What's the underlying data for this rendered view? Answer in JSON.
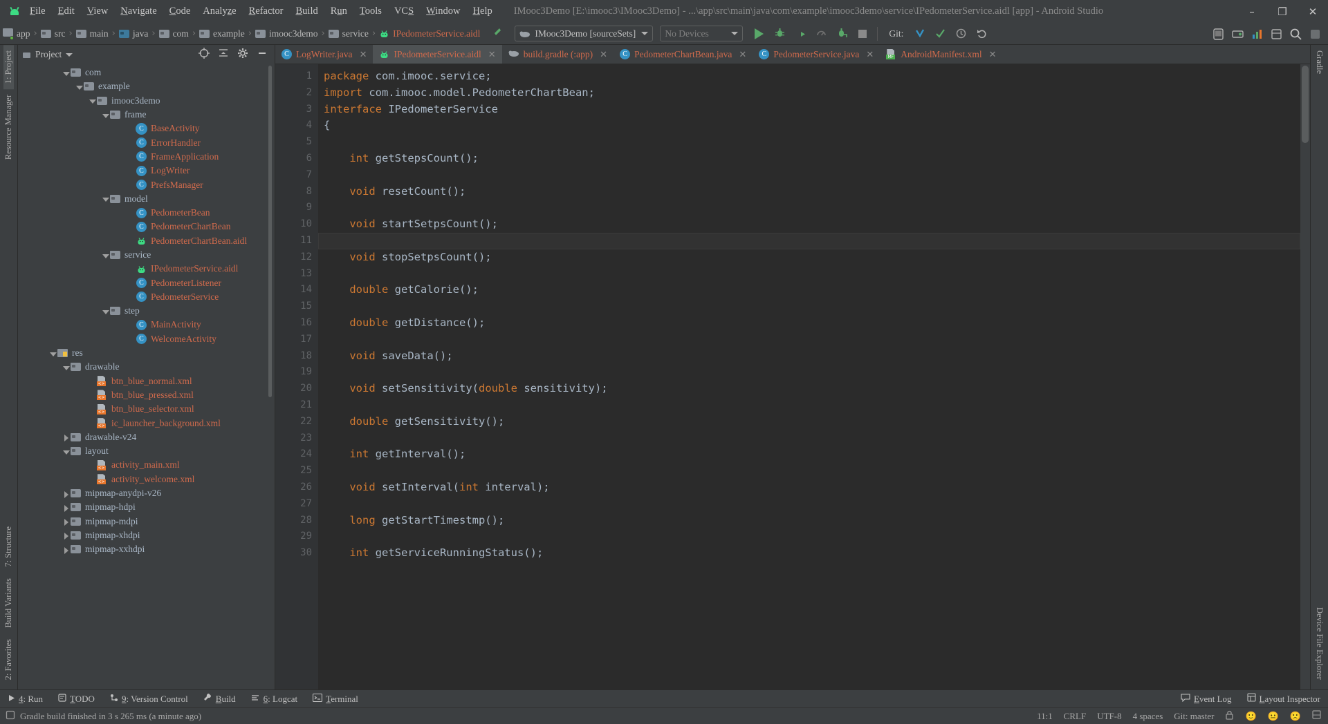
{
  "window": {
    "title": "IMooc3Demo [E:\\imooc3\\IMooc3Demo] - ...\\app\\src\\main\\java\\com\\example\\imooc3demo\\service\\IPedometerService.aidl [app] - Android Studio",
    "minimize": "–",
    "maximize": "❐",
    "close": "✕",
    "app_icon": "android-logo"
  },
  "menu": [
    {
      "label": "File",
      "mnemonic": "F"
    },
    {
      "label": "Edit",
      "mnemonic": "E"
    },
    {
      "label": "View",
      "mnemonic": "V"
    },
    {
      "label": "Navigate",
      "mnemonic": "N"
    },
    {
      "label": "Code",
      "mnemonic": "C"
    },
    {
      "label": "Analyze",
      "mnemonic": "z"
    },
    {
      "label": "Refactor",
      "mnemonic": "R"
    },
    {
      "label": "Build",
      "mnemonic": "B"
    },
    {
      "label": "Run",
      "mnemonic": "u"
    },
    {
      "label": "Tools",
      "mnemonic": "T"
    },
    {
      "label": "VCS",
      "mnemonic": "S"
    },
    {
      "label": "Window",
      "mnemonic": "W"
    },
    {
      "label": "Help",
      "mnemonic": "H"
    }
  ],
  "breadcrumbs": [
    {
      "label": "app",
      "icon": "module-folder-icon"
    },
    {
      "label": "src",
      "icon": "folder-icon"
    },
    {
      "label": "main",
      "icon": "folder-icon"
    },
    {
      "label": "java",
      "icon": "source-folder-icon"
    },
    {
      "label": "com",
      "icon": "package-icon"
    },
    {
      "label": "example",
      "icon": "package-icon"
    },
    {
      "label": "imooc3demo",
      "icon": "package-icon"
    },
    {
      "label": "service",
      "icon": "package-icon"
    },
    {
      "label": "IPedometerService.aidl",
      "icon": "aidl-icon"
    }
  ],
  "toolbar": {
    "run_config": "IMooc3Demo [sourceSets]",
    "devices": "No Devices",
    "git_label": "Git:",
    "actions": [
      "run-icon",
      "debug-icon",
      "run-coverage-icon",
      "profiler-icon",
      "attach-debugger-icon",
      "stop-icon"
    ],
    "git_actions": [
      "update-project-icon",
      "commit-icon",
      "history-icon",
      "revert-icon"
    ],
    "right_actions": [
      "avd-manager-icon",
      "sdk-manager-icon",
      "search-icon"
    ]
  },
  "project_panel": {
    "title": "1: Project",
    "title_short": "Project",
    "tools": [
      "target-icon",
      "collapse-all-icon",
      "settings-icon",
      "hide-icon"
    ],
    "tree": [
      {
        "label": "com",
        "indent": 3,
        "type": "package",
        "expanded": true
      },
      {
        "label": "example",
        "indent": 4,
        "type": "package",
        "expanded": true
      },
      {
        "label": "imooc3demo",
        "indent": 5,
        "type": "package",
        "expanded": true
      },
      {
        "label": "frame",
        "indent": 6,
        "type": "package",
        "expanded": true
      },
      {
        "label": "BaseActivity",
        "indent": 8,
        "type": "class-abstract"
      },
      {
        "label": "ErrorHandler",
        "indent": 8,
        "type": "class"
      },
      {
        "label": "FrameApplication",
        "indent": 8,
        "type": "class"
      },
      {
        "label": "LogWriter",
        "indent": 8,
        "type": "class"
      },
      {
        "label": "PrefsManager",
        "indent": 8,
        "type": "class"
      },
      {
        "label": "model",
        "indent": 6,
        "type": "package",
        "expanded": true
      },
      {
        "label": "PedometerBean",
        "indent": 8,
        "type": "class"
      },
      {
        "label": "PedometerChartBean",
        "indent": 8,
        "type": "class"
      },
      {
        "label": "PedometerChartBean.aidl",
        "indent": 8,
        "type": "aidl"
      },
      {
        "label": "service",
        "indent": 6,
        "type": "package",
        "expanded": true
      },
      {
        "label": "IPedometerService.aidl",
        "indent": 8,
        "type": "aidl"
      },
      {
        "label": "PedometerListener",
        "indent": 8,
        "type": "class"
      },
      {
        "label": "PedometerService",
        "indent": 8,
        "type": "class"
      },
      {
        "label": "step",
        "indent": 6,
        "type": "package",
        "expanded": true
      },
      {
        "label": "MainActivity",
        "indent": 8,
        "type": "class"
      },
      {
        "label": "WelcomeActivity",
        "indent": 8,
        "type": "class"
      },
      {
        "label": "res",
        "indent": 2,
        "type": "res-folder",
        "expanded": true
      },
      {
        "label": "drawable",
        "indent": 3,
        "type": "folder",
        "expanded": true
      },
      {
        "label": "btn_blue_normal.xml",
        "indent": 5,
        "type": "xml"
      },
      {
        "label": "btn_blue_pressed.xml",
        "indent": 5,
        "type": "xml"
      },
      {
        "label": "btn_blue_selector.xml",
        "indent": 5,
        "type": "xml"
      },
      {
        "label": "ic_launcher_background.xml",
        "indent": 5,
        "type": "xml"
      },
      {
        "label": "drawable-v24",
        "indent": 3,
        "type": "folder",
        "collapsed": true
      },
      {
        "label": "layout",
        "indent": 3,
        "type": "folder",
        "expanded": true
      },
      {
        "label": "activity_main.xml",
        "indent": 5,
        "type": "xml"
      },
      {
        "label": "activity_welcome.xml",
        "indent": 5,
        "type": "xml"
      },
      {
        "label": "mipmap-anydpi-v26",
        "indent": 3,
        "type": "folder",
        "collapsed": true
      },
      {
        "label": "mipmap-hdpi",
        "indent": 3,
        "type": "folder",
        "collapsed": true
      },
      {
        "label": "mipmap-mdpi",
        "indent": 3,
        "type": "folder",
        "collapsed": true
      },
      {
        "label": "mipmap-xhdpi",
        "indent": 3,
        "type": "folder",
        "collapsed": true
      },
      {
        "label": "mipmap-xxhdpi",
        "indent": 3,
        "type": "folder",
        "collapsed": true
      }
    ]
  },
  "left_strip": [
    {
      "label": "1: Project",
      "selected": true
    },
    {
      "label": "Resource Manager",
      "selected": false
    }
  ],
  "left_strip_bottom": [
    {
      "label": "7: Structure"
    },
    {
      "label": "Build Variants"
    },
    {
      "label": "2: Favorites"
    }
  ],
  "right_strip": [
    {
      "label": "Gradle"
    }
  ],
  "right_strip_bottom": [
    {
      "label": "Device File Explorer"
    }
  ],
  "editor_tabs": [
    {
      "label": "LogWriter.java",
      "icon": "java-class-icon",
      "active": false
    },
    {
      "label": "IPedometerService.aidl",
      "icon": "aidl-icon",
      "active": true
    },
    {
      "label": "build.gradle (:app)",
      "icon": "gradle-icon",
      "active": false
    },
    {
      "label": "PedometerChartBean.java",
      "icon": "java-class-icon",
      "active": false
    },
    {
      "label": "PedometerService.java",
      "icon": "java-class-icon",
      "active": false
    },
    {
      "label": "AndroidManifest.xml",
      "icon": "manifest-icon",
      "active": false
    }
  ],
  "editor": {
    "first_line": 1,
    "cursor_line": 11,
    "lines": [
      {
        "n": 1,
        "tokens": [
          {
            "t": "package ",
            "c": "kw"
          },
          {
            "t": "com.imooc.service;",
            "c": "txt"
          }
        ]
      },
      {
        "n": 2,
        "tokens": [
          {
            "t": "import ",
            "c": "kw"
          },
          {
            "t": "com.imooc.model.PedometerChartBean;",
            "c": "txt"
          }
        ]
      },
      {
        "n": 3,
        "tokens": [
          {
            "t": "interface ",
            "c": "kw"
          },
          {
            "t": "IPedometerService",
            "c": "txt"
          }
        ]
      },
      {
        "n": 4,
        "tokens": [
          {
            "t": "{",
            "c": "txt"
          }
        ]
      },
      {
        "n": 5,
        "tokens": []
      },
      {
        "n": 6,
        "tokens": [
          {
            "t": "    ",
            "c": "txt"
          },
          {
            "t": "int ",
            "c": "kw"
          },
          {
            "t": "getStepsCount();",
            "c": "txt"
          }
        ]
      },
      {
        "n": 7,
        "tokens": []
      },
      {
        "n": 8,
        "tokens": [
          {
            "t": "    ",
            "c": "txt"
          },
          {
            "t": "void ",
            "c": "kw"
          },
          {
            "t": "resetCount();",
            "c": "txt"
          }
        ]
      },
      {
        "n": 9,
        "tokens": []
      },
      {
        "n": 10,
        "tokens": [
          {
            "t": "    ",
            "c": "txt"
          },
          {
            "t": "void ",
            "c": "kw"
          },
          {
            "t": "startSetpsCount();",
            "c": "txt"
          }
        ]
      },
      {
        "n": 11,
        "tokens": []
      },
      {
        "n": 12,
        "tokens": [
          {
            "t": "    ",
            "c": "txt"
          },
          {
            "t": "void ",
            "c": "kw"
          },
          {
            "t": "stopSetpsCount();",
            "c": "txt"
          }
        ]
      },
      {
        "n": 13,
        "tokens": []
      },
      {
        "n": 14,
        "tokens": [
          {
            "t": "    ",
            "c": "txt"
          },
          {
            "t": "double ",
            "c": "kw"
          },
          {
            "t": "getCalorie();",
            "c": "txt"
          }
        ]
      },
      {
        "n": 15,
        "tokens": []
      },
      {
        "n": 16,
        "tokens": [
          {
            "t": "    ",
            "c": "txt"
          },
          {
            "t": "double ",
            "c": "kw"
          },
          {
            "t": "getDistance();",
            "c": "txt"
          }
        ]
      },
      {
        "n": 17,
        "tokens": []
      },
      {
        "n": 18,
        "tokens": [
          {
            "t": "    ",
            "c": "txt"
          },
          {
            "t": "void ",
            "c": "kw"
          },
          {
            "t": "saveData();",
            "c": "txt"
          }
        ]
      },
      {
        "n": 19,
        "tokens": []
      },
      {
        "n": 20,
        "tokens": [
          {
            "t": "    ",
            "c": "txt"
          },
          {
            "t": "void ",
            "c": "kw"
          },
          {
            "t": "setSensitivity(",
            "c": "txt"
          },
          {
            "t": "double ",
            "c": "kw"
          },
          {
            "t": "sensitivity);",
            "c": "txt"
          }
        ]
      },
      {
        "n": 21,
        "tokens": []
      },
      {
        "n": 22,
        "tokens": [
          {
            "t": "    ",
            "c": "txt"
          },
          {
            "t": "double ",
            "c": "kw"
          },
          {
            "t": "getSensitivity();",
            "c": "txt"
          }
        ]
      },
      {
        "n": 23,
        "tokens": []
      },
      {
        "n": 24,
        "tokens": [
          {
            "t": "    ",
            "c": "txt"
          },
          {
            "t": "int ",
            "c": "kw"
          },
          {
            "t": "getInterval();",
            "c": "txt"
          }
        ]
      },
      {
        "n": 25,
        "tokens": []
      },
      {
        "n": 26,
        "tokens": [
          {
            "t": "    ",
            "c": "txt"
          },
          {
            "t": "void ",
            "c": "kw"
          },
          {
            "t": "setInterval(",
            "c": "txt"
          },
          {
            "t": "int ",
            "c": "kw"
          },
          {
            "t": "interval);",
            "c": "txt"
          }
        ]
      },
      {
        "n": 27,
        "tokens": []
      },
      {
        "n": 28,
        "tokens": [
          {
            "t": "    ",
            "c": "txt"
          },
          {
            "t": "long ",
            "c": "kw"
          },
          {
            "t": "getStartTimestmp();",
            "c": "txt"
          }
        ]
      },
      {
        "n": 29,
        "tokens": []
      },
      {
        "n": 30,
        "tokens": [
          {
            "t": "    ",
            "c": "txt"
          },
          {
            "t": "int ",
            "c": "kw"
          },
          {
            "t": "getServiceRunningStatus();",
            "c": "txt"
          }
        ]
      }
    ]
  },
  "bottom_bar": [
    {
      "label": "4: Run",
      "num": "4",
      "icon": "run-icon"
    },
    {
      "label": "TODO",
      "num": "",
      "icon": "todo-icon"
    },
    {
      "label": "9: Version Control",
      "num": "9",
      "icon": "vcs-icon"
    },
    {
      "label": "Build",
      "num": "",
      "icon": "build-icon"
    },
    {
      "label": "6: Logcat",
      "num": "6",
      "icon": "logcat-icon"
    },
    {
      "label": "Terminal",
      "num": "",
      "icon": "terminal-icon"
    }
  ],
  "bottom_bar_right": [
    {
      "label": "Event Log",
      "icon": "event-log-icon"
    },
    {
      "label": "Layout Inspector",
      "icon": "layout-inspector-icon"
    }
  ],
  "status_bar": {
    "message": "Gradle build finished in 3 s 265 ms (a minute ago)",
    "caret": "11:1",
    "line_sep": "CRLF",
    "encoding": "UTF-8",
    "indent": "4 spaces",
    "branch": "Git: master",
    "lock_icon": "lock-icon",
    "faces": [
      "🙂",
      "😐",
      "🙁"
    ]
  },
  "colors": {
    "chrome": "#3c3f41",
    "editor_bg": "#2b2b2b",
    "gutter_bg": "#313335",
    "accent_green": "#3ddc84",
    "keyword_orange": "#cc7832",
    "file_red": "#cf6a4c",
    "folder_blue": "#3592c4",
    "text": "#a9b7c6"
  }
}
